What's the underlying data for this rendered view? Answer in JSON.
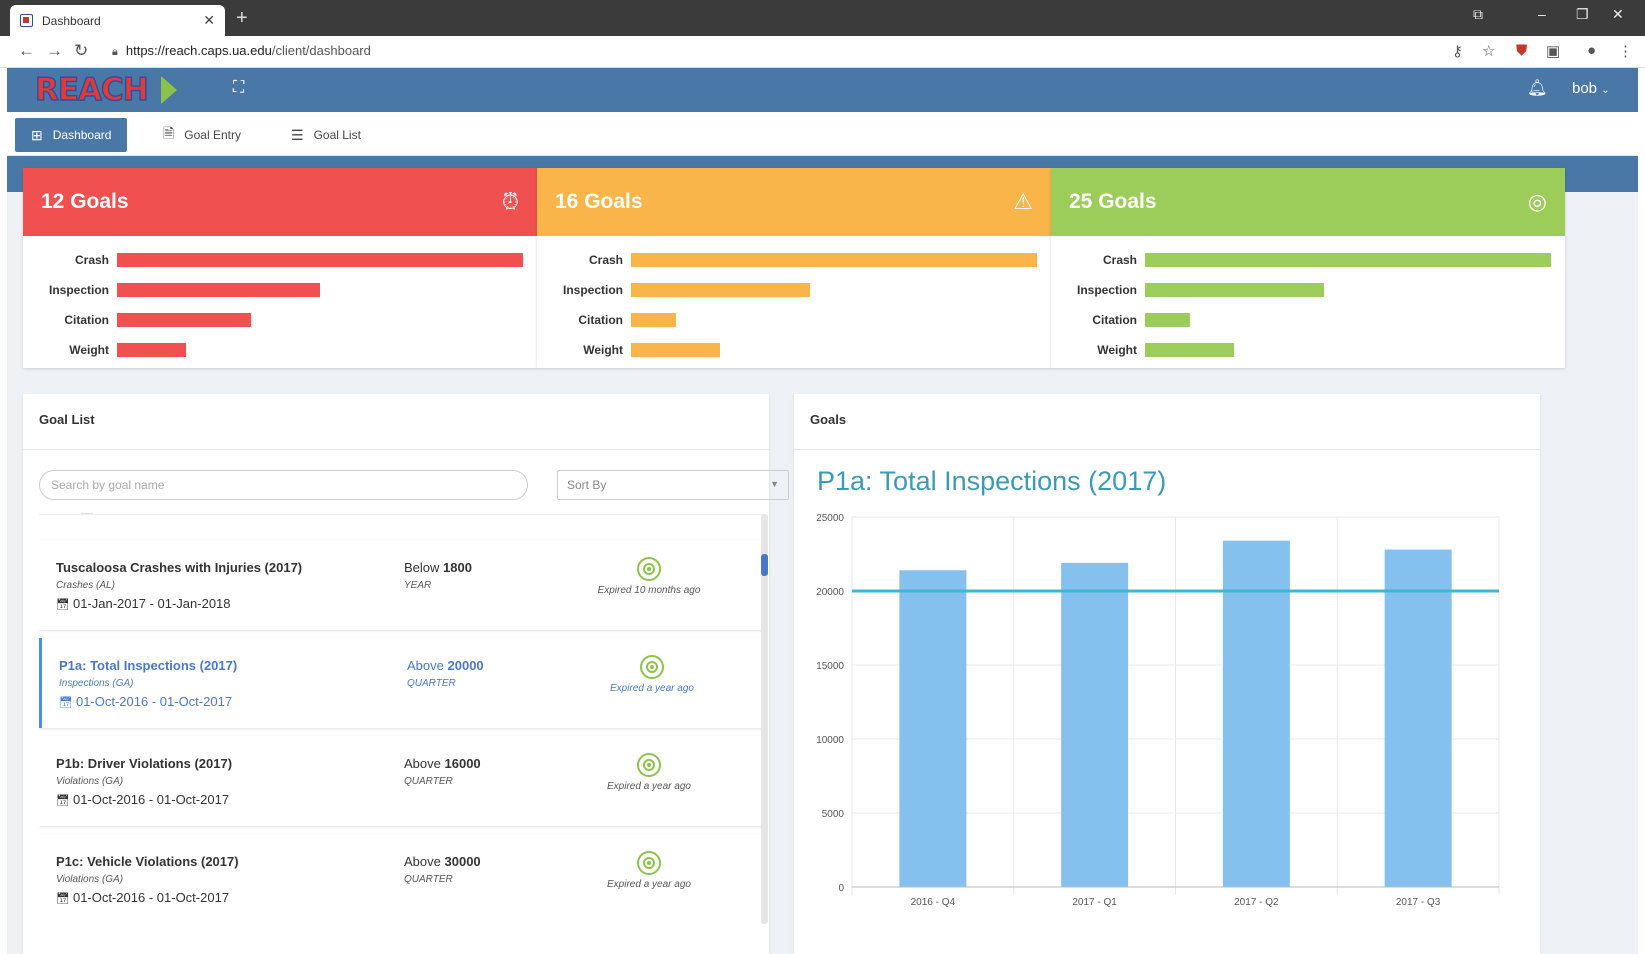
{
  "browser": {
    "tab_title": "Dashboard",
    "url_host": "https://reach.caps.ua.edu",
    "url_path": "/client/dashboard"
  },
  "app": {
    "logo_text": "REACH",
    "user": "bob",
    "colors": {
      "header": "#4a78a6",
      "red": "#f05050",
      "orange": "#f9b44a",
      "green": "#9ccc5a"
    }
  },
  "subnav": {
    "dashboard": "Dashboard",
    "goal_entry": "Goal Entry",
    "goal_list": "Goal List"
  },
  "stats": [
    {
      "count_label": "12 Goals",
      "color": "#f05050",
      "icon": "alarm-clock-icon",
      "rows": [
        {
          "label": "Crash",
          "value": 1.0
        },
        {
          "label": "Inspection",
          "value": 0.5
        },
        {
          "label": "Citation",
          "value": 0.33
        },
        {
          "label": "Weight",
          "value": 0.17
        }
      ]
    },
    {
      "count_label": "16 Goals",
      "color": "#f9b44a",
      "icon": "warning-icon",
      "rows": [
        {
          "label": "Crash",
          "value": 1.0
        },
        {
          "label": "Inspection",
          "value": 0.44
        },
        {
          "label": "Citation",
          "value": 0.11
        },
        {
          "label": "Weight",
          "value": 0.22
        }
      ]
    },
    {
      "count_label": "25 Goals",
      "color": "#9ccc5a",
      "icon": "target-icon",
      "rows": [
        {
          "label": "Crash",
          "value": 1.0
        },
        {
          "label": "Inspection",
          "value": 0.44
        },
        {
          "label": "Citation",
          "value": 0.11
        },
        {
          "label": "Weight",
          "value": 0.22
        }
      ]
    }
  ],
  "goal_list": {
    "title": "Goal List",
    "search_placeholder": "Search by goal name",
    "sort_placeholder": "Sort By",
    "items": [
      {
        "name": "Tuscaloosa Crashes with Injuries (2017)",
        "category": "Crashes (AL)",
        "dates": "01-Jan-2017 - 01-Jan-2018",
        "dir": "Below",
        "target": "1800",
        "period": "YEAR",
        "expired": "Expired 10 months ago"
      },
      {
        "name": "P1a: Total Inspections (2017)",
        "category": "Inspections (GA)",
        "dates": "01-Oct-2016 - 01-Oct-2017",
        "dir": "Above",
        "target": "20000",
        "period": "QUARTER",
        "expired": "Expired a year ago"
      },
      {
        "name": "P1b: Driver Violations (2017)",
        "category": "Violations (GA)",
        "dates": "01-Oct-2016 - 01-Oct-2017",
        "dir": "Above",
        "target": "16000",
        "period": "QUARTER",
        "expired": "Expired a year ago"
      },
      {
        "name": "P1c: Vehicle Violations (2017)",
        "category": "Violations (GA)",
        "dates": "01-Oct-2016 - 01-Oct-2017",
        "dir": "Above",
        "target": "30000",
        "period": "QUARTER",
        "expired": "Expired a year ago"
      }
    ]
  },
  "goals_panel": {
    "title": "Goals"
  },
  "chart_data": {
    "type": "bar",
    "title": "P1a: Total Inspections (2017)",
    "categories": [
      "2016 - Q4",
      "2017 - Q1",
      "2017 - Q2",
      "2017 - Q3"
    ],
    "values": [
      21400,
      21900,
      23400,
      22800
    ],
    "goal_line": 20000,
    "ylim": [
      0,
      25000
    ],
    "yticks": [
      "0",
      "5000",
      "10000",
      "15000",
      "20000",
      "25000"
    ],
    "bar_color": "#85c1ee",
    "line_color": "#3bb8d4",
    "grid": true
  }
}
